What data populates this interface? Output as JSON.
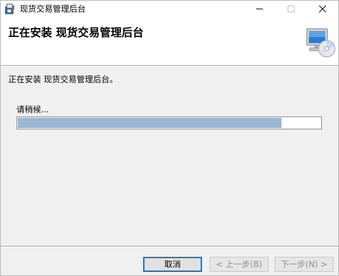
{
  "window": {
    "title": "现货交易管理后台",
    "app_icon": "installer-box-icon",
    "caption_buttons": [
      "minimize-icon",
      "maximize-icon",
      "close-icon"
    ]
  },
  "banner": {
    "title": "正在安装 现货交易管理后台",
    "icon": "computer-cd-icon"
  },
  "main": {
    "status_text": "正在安装 现货交易管理后台。",
    "wait_text": "请稍候...",
    "progress": 0.87,
    "progress_color": "#9bb5d4"
  },
  "buttons": {
    "cancel": "取消",
    "back": "< 上一步(B)",
    "next": "下一步(N) >"
  },
  "colors": {
    "focus_border": "#0078d7",
    "disabled_text": "#8e8e8e"
  }
}
